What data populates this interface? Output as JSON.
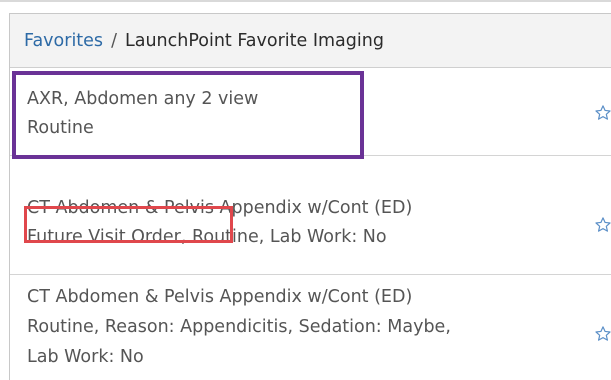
{
  "breadcrumb": {
    "parent": "Favorites",
    "separator": "/",
    "current": "LaunchPoint Favorite Imaging"
  },
  "favorites": [
    {
      "title": "AXR, Abdomen any 2 view",
      "details": [
        "Routine"
      ],
      "favorite_icon": "star-outline-icon"
    },
    {
      "title": "CT Abdomen & Pelvis Appendix w/Cont (ED)",
      "details": [
        "Future Visit Order, Routine, Lab Work: No"
      ],
      "favorite_icon": "star-outline-icon"
    },
    {
      "title": "CT Abdomen & Pelvis Appendix w/Cont (ED)",
      "details": [
        "Routine, Reason: Appendicitis, Sedation: Maybe,",
        "Lab Work: No"
      ],
      "favorite_icon": "star-outline-icon"
    }
  ],
  "colors": {
    "link": "#2d6aa6",
    "text": "#555555",
    "highlight_purple": "#6a3296",
    "highlight_red": "#e0474c",
    "star": "#5b8fc7"
  }
}
